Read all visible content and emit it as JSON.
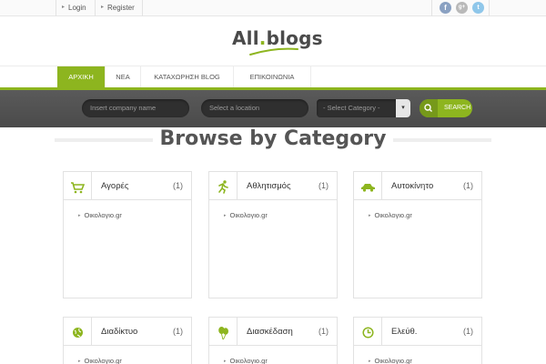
{
  "topbar": {
    "login": "Login",
    "register": "Register",
    "social": [
      {
        "name": "facebook-icon",
        "glyph": "f"
      },
      {
        "name": "google-plus-icon",
        "glyph": "g+"
      },
      {
        "name": "twitter-icon",
        "glyph": "t"
      }
    ]
  },
  "logo": {
    "part1": "All",
    "dot": ".",
    "part2": "blogs"
  },
  "nav": {
    "items": [
      "ΑΡΧΙΚΗ",
      "ΝΕΑ",
      "ΚΑΤΑΧΩΡΗΣΗ BLOG",
      "ΕΠΙΚΟΙΝΩΝΙΑ"
    ],
    "active": "ΑΡΧΙΚΗ"
  },
  "search": {
    "company_placeholder": "Insert company name",
    "location_placeholder": "Select a location",
    "category_selected": "- Select Category -",
    "button_label": "SEARCH"
  },
  "heading": "Browse by Category",
  "categories": [
    {
      "icon": "cart-icon",
      "name": "Αγορές",
      "count": "(1)",
      "item": "Οικολογιο.gr"
    },
    {
      "icon": "running-icon",
      "name": "Αθλητισμός",
      "count": "(1)",
      "item": "Οικολογιο.gr"
    },
    {
      "icon": "car-icon",
      "name": "Αυτοκίνητο",
      "count": "(1)",
      "item": "Οικολογιο.gr"
    },
    {
      "icon": "globe-icon",
      "name": "Διαδίκτυο",
      "count": "(1)",
      "item": "Οικολογιο.gr"
    },
    {
      "icon": "balloons-icon",
      "name": "Διασκέδαση",
      "count": "(1)",
      "item": "Οικολογιο.gr"
    },
    {
      "icon": "clock-icon",
      "name": "Ελεύθ.",
      "count": "(1)",
      "item": "Οικολογιο.gr"
    }
  ],
  "colors": {
    "accent": "#8db51f",
    "band": "#505050"
  }
}
